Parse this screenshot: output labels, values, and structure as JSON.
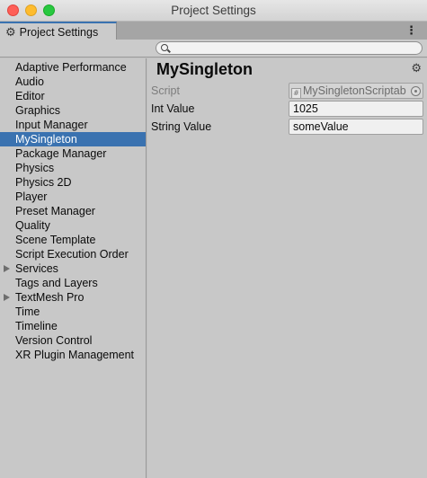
{
  "window": {
    "title": "Project Settings"
  },
  "tab": {
    "label": "Project Settings",
    "icon": "gear-icon"
  },
  "search": {
    "placeholder": "",
    "value": ""
  },
  "sidebar": {
    "items": [
      {
        "label": "Adaptive Performance",
        "expandable": false,
        "selected": false
      },
      {
        "label": "Audio",
        "expandable": false,
        "selected": false
      },
      {
        "label": "Editor",
        "expandable": false,
        "selected": false
      },
      {
        "label": "Graphics",
        "expandable": false,
        "selected": false
      },
      {
        "label": "Input Manager",
        "expandable": false,
        "selected": false
      },
      {
        "label": "MySingleton",
        "expandable": false,
        "selected": true
      },
      {
        "label": "Package Manager",
        "expandable": false,
        "selected": false
      },
      {
        "label": "Physics",
        "expandable": false,
        "selected": false
      },
      {
        "label": "Physics 2D",
        "expandable": false,
        "selected": false
      },
      {
        "label": "Player",
        "expandable": false,
        "selected": false
      },
      {
        "label": "Preset Manager",
        "expandable": false,
        "selected": false
      },
      {
        "label": "Quality",
        "expandable": false,
        "selected": false
      },
      {
        "label": "Scene Template",
        "expandable": false,
        "selected": false
      },
      {
        "label": "Script Execution Order",
        "expandable": false,
        "selected": false
      },
      {
        "label": "Services",
        "expandable": true,
        "selected": false
      },
      {
        "label": "Tags and Layers",
        "expandable": false,
        "selected": false
      },
      {
        "label": "TextMesh Pro",
        "expandable": true,
        "selected": false
      },
      {
        "label": "Time",
        "expandable": false,
        "selected": false
      },
      {
        "label": "Timeline",
        "expandable": false,
        "selected": false
      },
      {
        "label": "Version Control",
        "expandable": false,
        "selected": false
      },
      {
        "label": "XR Plugin Management",
        "expandable": false,
        "selected": false
      }
    ]
  },
  "inspector": {
    "title": "MySingleton",
    "fields": {
      "script": {
        "label": "Script",
        "value": "MySingletonScriptab"
      },
      "int_value": {
        "label": "Int Value",
        "value": "1025"
      },
      "string_value": {
        "label": "String Value",
        "value": "someValue"
      }
    }
  },
  "colors": {
    "selection": "#3a72b0",
    "panel": "#c8c8c8"
  }
}
